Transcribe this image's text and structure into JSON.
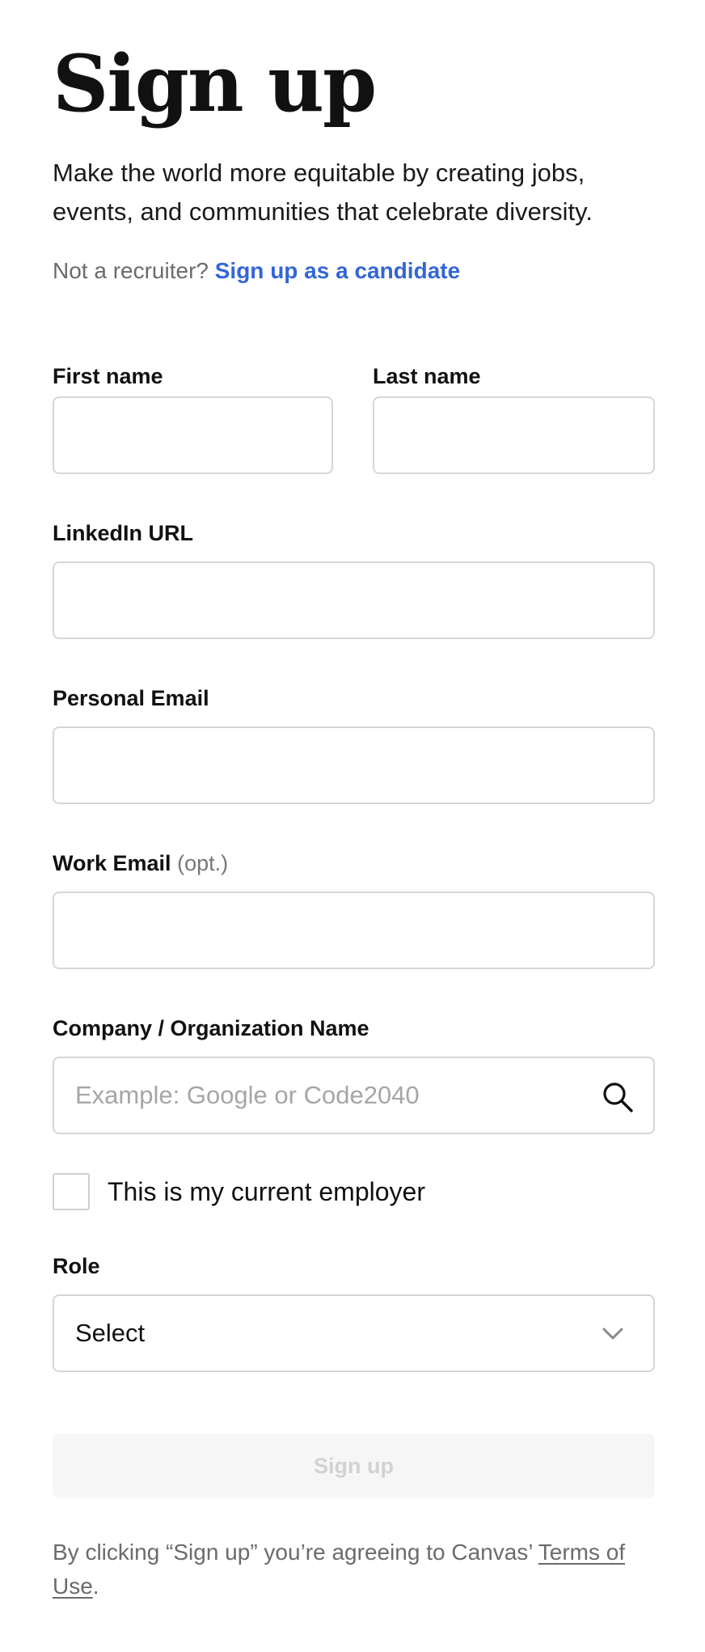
{
  "header": {
    "title": "Sign up",
    "subtitle": "Make the world more equitable by creating jobs, events, and communities that celebrate diversity.",
    "alt_prompt": "Not a recruiter?",
    "alt_link": "Sign up as a candidate"
  },
  "form": {
    "first_name": {
      "label": "First name",
      "value": ""
    },
    "last_name": {
      "label": "Last name",
      "value": ""
    },
    "linkedin_url": {
      "label": "LinkedIn URL",
      "value": ""
    },
    "personal_email": {
      "label": "Personal Email",
      "value": ""
    },
    "work_email": {
      "label": "Work Email",
      "optional_tag": "(opt.)",
      "value": ""
    },
    "company": {
      "label": "Company / Organization Name",
      "placeholder": "Example: Google or Code2040",
      "value": "",
      "icon": "search-icon"
    },
    "current_employer": {
      "label": "This is my current employer",
      "checked": false
    },
    "role": {
      "label": "Role",
      "selected": "Select",
      "icon": "chevron-down-icon"
    },
    "submit_label": "Sign up"
  },
  "footer": {
    "terms_prefix": "By clicking “Sign up” you’re agreeing to Canvas’ ",
    "terms_link": "Terms of Use",
    "terms_suffix": "."
  },
  "colors": {
    "link": "#3366d6",
    "muted_text": "#6b6b6b",
    "border": "#d6d6d6",
    "disabled_button_bg": "#f6f6f6",
    "disabled_button_text": "#d2d2d2"
  }
}
